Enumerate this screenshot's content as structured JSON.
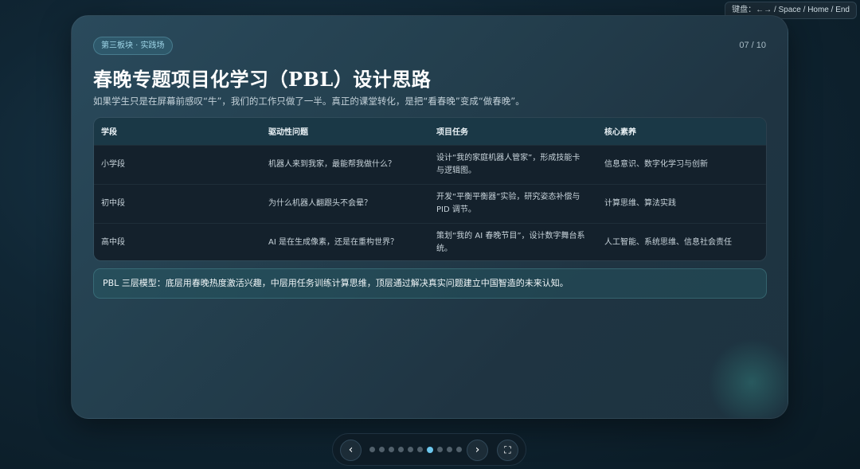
{
  "keyboard_hint": "键盘：←→ / Space / Home / End",
  "slide": {
    "tag": "第三板块 · 实践场",
    "page_number": "07 / 10",
    "title": "春晚专题项目化学习（PBL）设计思路",
    "subtitle": "如果学生只是在屏幕前感叹“牛”，我们的工作只做了一半。真正的课堂转化，是把“看春晚”变成“做春晚”。",
    "table": {
      "headers": [
        "学段",
        "驱动性问题",
        "项目任务",
        "核心素养"
      ],
      "rows": [
        [
          "小学段",
          "机器人来到我家，最能帮我做什么？",
          "设计“我的家庭机器人管家”，形成技能卡与逻辑图。",
          "信息意识、数字化学习与创新"
        ],
        [
          "初中段",
          "为什么机器人翻跟头不会晕？",
          "开发“平衡平衡器”实验，研究姿态补偿与 PID 调节。",
          "计算思维、算法实践"
        ],
        [
          "高中段",
          "AI 是在生成像素，还是在重构世界？",
          "策划“我的 AI 春晚节目”，设计数字舞台系统。",
          "人工智能、系统思维、信息社会责任"
        ]
      ]
    },
    "callout": "PBL 三层模型：底层用春晚热度激活兴趣，中层用任务训练计算思维，顶层通过解决真实问题建立中国智造的未来认知。"
  },
  "nav": {
    "prev_label": "‹",
    "next_label": "›",
    "fullscreen_label": "⛶",
    "total_slides": 10,
    "current_slide": 7
  },
  "colors": {
    "accent": "#6cc7ee",
    "tag_text": "#9fd6e8",
    "table_header_bg": "#1a3846",
    "table_row_bg": "#14212c"
  }
}
